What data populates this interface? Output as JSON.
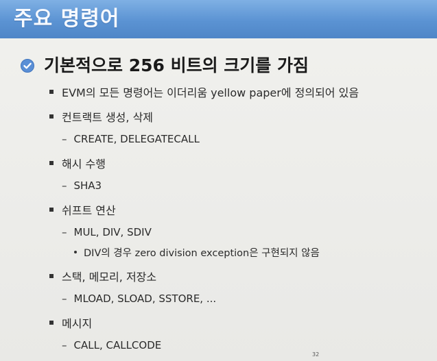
{
  "title": "주요 명령어",
  "main_point": "기본적으로 256 비트의 크기를 가짐",
  "items": [
    {
      "level": 1,
      "text": "EVM의 모든 명령어는 이더리움 yellow paper에 정의되어 있음"
    },
    {
      "level": 1,
      "text": "컨트랙트 생성, 삭제"
    },
    {
      "level": 2,
      "text": "CREATE, DELEGATECALL"
    },
    {
      "level": 1,
      "text": "해시 수행"
    },
    {
      "level": 2,
      "text": "SHA3"
    },
    {
      "level": 1,
      "text": "쉬프트 연산"
    },
    {
      "level": 2,
      "text": "MUL, DIV, SDIV"
    },
    {
      "level": 3,
      "text": "DIV의 경우 zero division exception은 구현되지 않음"
    },
    {
      "level": 1,
      "text": "스택, 메모리, 저장소"
    },
    {
      "level": 2,
      "text": "MLOAD, SLOAD, SSTORE, ..."
    },
    {
      "level": 1,
      "text": "메시지"
    },
    {
      "level": 2,
      "text": "CALL, CALLCODE"
    }
  ],
  "page_number": "32",
  "colors": {
    "title_bar": "#5b93d3",
    "check_icon": "#5a8fd6"
  },
  "icons": {
    "main_bullet": "check-circle-icon"
  }
}
